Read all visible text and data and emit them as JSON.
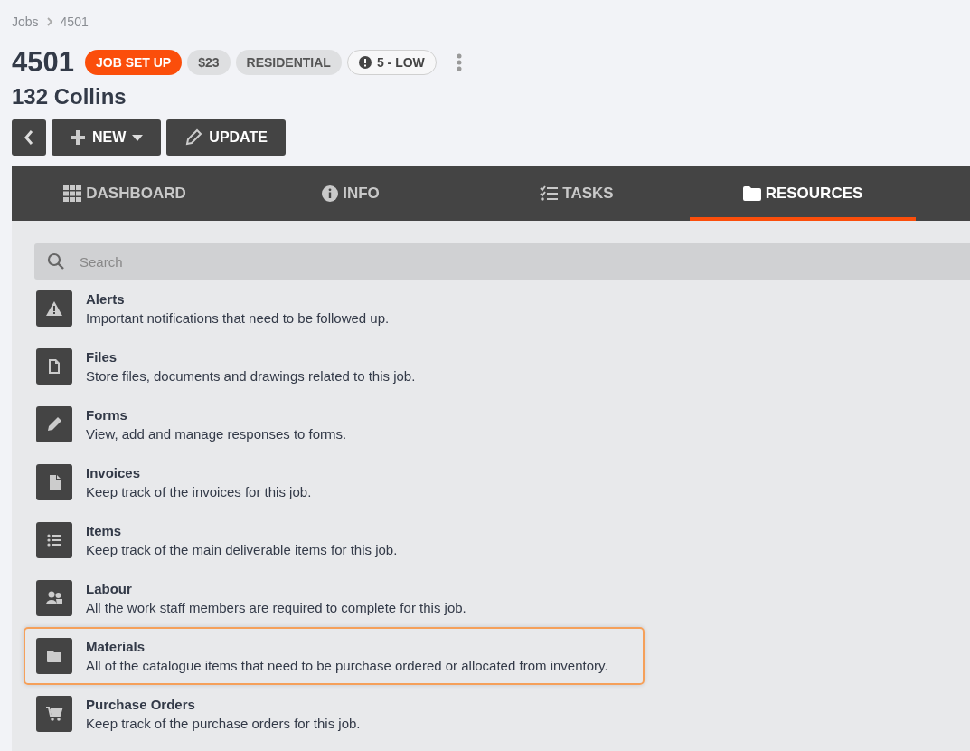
{
  "breadcrumb": [
    {
      "label": "Jobs"
    },
    {
      "label": "4501"
    }
  ],
  "job": {
    "number": "4501",
    "address": "132 Collins"
  },
  "badges": [
    {
      "kind": "status",
      "label": "JOB SET UP"
    },
    {
      "kind": "price",
      "label": "$23"
    },
    {
      "kind": "type",
      "label": "RESIDENTIAL"
    },
    {
      "kind": "priority",
      "label": "5 - LOW"
    }
  ],
  "actions": [
    {
      "kind": "back"
    },
    {
      "kind": "new",
      "label": "NEW"
    },
    {
      "kind": "update",
      "label": "UPDATE"
    }
  ],
  "tabs": [
    {
      "kind": "dashboard",
      "label": "DASHBOARD",
      "selected": false
    },
    {
      "kind": "info",
      "label": "INFO",
      "selected": false
    },
    {
      "kind": "tasks",
      "label": "TASKS",
      "selected": false
    },
    {
      "kind": "resources",
      "label": "RESOURCES",
      "selected": true
    }
  ],
  "search": {
    "placeholder": "Search"
  },
  "resources": [
    {
      "kind": "alert",
      "title": "Alerts",
      "description": "Important notifications that need to be followed up.",
      "selected": false
    },
    {
      "kind": "file",
      "title": "Files",
      "description": "Store files, documents and drawings related to this job.",
      "selected": false
    },
    {
      "kind": "pencil",
      "title": "Forms",
      "description": "View, add and manage responses to forms.",
      "selected": false
    },
    {
      "kind": "document",
      "title": "Invoices",
      "description": "Keep track of the invoices for this job.",
      "selected": false
    },
    {
      "kind": "list",
      "title": "Items",
      "description": "Keep track of the main deliverable items for this job.",
      "selected": false
    },
    {
      "kind": "people",
      "title": "Labour",
      "description": "All the work staff members are required to complete for this job.",
      "selected": false
    },
    {
      "kind": "folder",
      "title": "Materials",
      "description": "All of the catalogue items that need to be purchase ordered or allocated from inventory.",
      "selected": true
    },
    {
      "kind": "cart",
      "title": "Purchase Orders",
      "description": "Keep track of the purchase orders for this job.",
      "selected": false
    }
  ]
}
